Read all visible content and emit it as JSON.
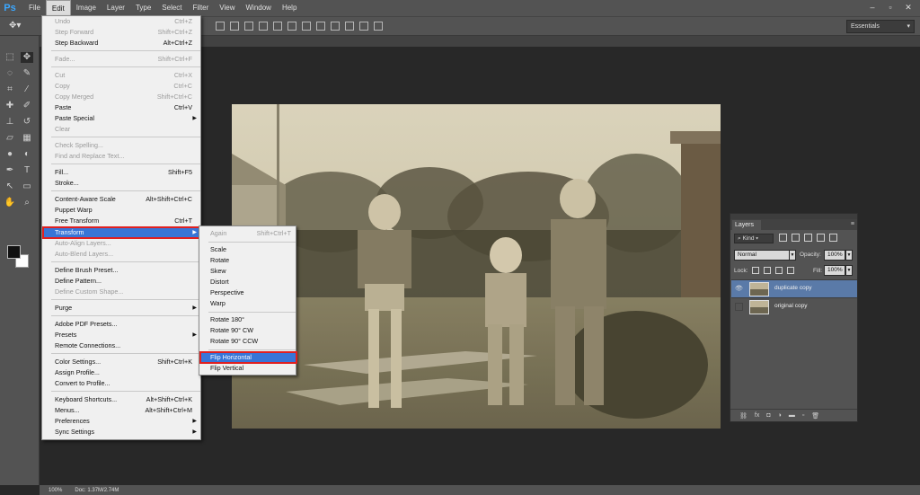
{
  "app": {
    "logo": "Ps"
  },
  "menubar": [
    "File",
    "Edit",
    "Image",
    "Layer",
    "Type",
    "Select",
    "Filter",
    "View",
    "Window",
    "Help"
  ],
  "window_controls": [
    "–",
    "▫",
    "✕"
  ],
  "options_bar": {
    "workspace": "Essentials"
  },
  "edit_menu": {
    "items": [
      {
        "label": "Undo",
        "shortcut": "Ctrl+Z",
        "disabled": true
      },
      {
        "label": "Step Forward",
        "shortcut": "Shift+Ctrl+Z",
        "disabled": true
      },
      {
        "label": "Step Backward",
        "shortcut": "Alt+Ctrl+Z",
        "disabled": false
      },
      {
        "label": "Fade...",
        "shortcut": "Shift+Ctrl+F",
        "disabled": true
      },
      {
        "label": "Cut",
        "shortcut": "Ctrl+X",
        "disabled": true
      },
      {
        "label": "Copy",
        "shortcut": "Ctrl+C",
        "disabled": true
      },
      {
        "label": "Copy Merged",
        "shortcut": "Shift+Ctrl+C",
        "disabled": true
      },
      {
        "label": "Paste",
        "shortcut": "Ctrl+V",
        "disabled": false
      },
      {
        "label": "Paste Special",
        "shortcut": "",
        "disabled": false
      },
      {
        "label": "Clear",
        "shortcut": "",
        "disabled": true
      },
      {
        "label": "Check Spelling...",
        "shortcut": "",
        "disabled": true
      },
      {
        "label": "Find and Replace Text...",
        "shortcut": "",
        "disabled": true
      },
      {
        "label": "Fill...",
        "shortcut": "Shift+F5",
        "disabled": false
      },
      {
        "label": "Stroke...",
        "shortcut": "",
        "disabled": false
      },
      {
        "label": "Content-Aware Scale",
        "shortcut": "Alt+Shift+Ctrl+C",
        "disabled": false
      },
      {
        "label": "Puppet Warp",
        "shortcut": "",
        "disabled": false
      },
      {
        "label": "Free Transform",
        "shortcut": "Ctrl+T",
        "disabled": false
      },
      {
        "label": "Transform",
        "shortcut": "",
        "disabled": false
      },
      {
        "label": "Auto-Align Layers...",
        "shortcut": "",
        "disabled": true
      },
      {
        "label": "Auto-Blend Layers...",
        "shortcut": "",
        "disabled": true
      },
      {
        "label": "Define Brush Preset...",
        "shortcut": "",
        "disabled": false
      },
      {
        "label": "Define Pattern...",
        "shortcut": "",
        "disabled": false
      },
      {
        "label": "Define Custom Shape...",
        "shortcut": "",
        "disabled": true
      },
      {
        "label": "Purge",
        "shortcut": "",
        "disabled": false
      },
      {
        "label": "Adobe PDF Presets...",
        "shortcut": "",
        "disabled": false
      },
      {
        "label": "Presets",
        "shortcut": "",
        "disabled": false
      },
      {
        "label": "Remote Connections...",
        "shortcut": "",
        "disabled": false
      },
      {
        "label": "Color Settings...",
        "shortcut": "Shift+Ctrl+K",
        "disabled": false
      },
      {
        "label": "Assign Profile...",
        "shortcut": "",
        "disabled": false
      },
      {
        "label": "Convert to Profile...",
        "shortcut": "",
        "disabled": false
      },
      {
        "label": "Keyboard Shortcuts...",
        "shortcut": "Alt+Shift+Ctrl+K",
        "disabled": false
      },
      {
        "label": "Menus...",
        "shortcut": "Alt+Shift+Ctrl+M",
        "disabled": false
      },
      {
        "label": "Preferences",
        "shortcut": "",
        "disabled": false
      },
      {
        "label": "Sync Settings",
        "shortcut": "",
        "disabled": false
      }
    ]
  },
  "transform_submenu": {
    "items": [
      {
        "label": "Again",
        "shortcut": "Shift+Ctrl+T",
        "disabled": true
      },
      {
        "label": "Scale",
        "shortcut": ""
      },
      {
        "label": "Rotate",
        "shortcut": ""
      },
      {
        "label": "Skew",
        "shortcut": ""
      },
      {
        "label": "Distort",
        "shortcut": ""
      },
      {
        "label": "Perspective",
        "shortcut": ""
      },
      {
        "label": "Warp",
        "shortcut": ""
      },
      {
        "label": "Rotate 180°",
        "shortcut": ""
      },
      {
        "label": "Rotate 90° CW",
        "shortcut": ""
      },
      {
        "label": "Rotate 90° CCW",
        "shortcut": ""
      },
      {
        "label": "Flip Horizontal",
        "shortcut": ""
      },
      {
        "label": "Flip Vertical",
        "shortcut": ""
      }
    ]
  },
  "layers_panel": {
    "tab": "Layers",
    "kind": "Kind",
    "blend_mode": "Normal",
    "opacity_label": "Opacity:",
    "opacity": "100%",
    "lock_label": "Lock:",
    "fill_label": "Fill:",
    "fill": "100%",
    "layers": [
      {
        "name": "duplicate copy",
        "selected": true,
        "visible": true
      },
      {
        "name": "original copy",
        "selected": false,
        "visible": false
      }
    ]
  },
  "status_bar": {
    "zoom": "100%",
    "doc": "Doc: 1.37M/2.74M"
  },
  "colors": {
    "menu_highlight": "#3875d7",
    "callout_outline": "#e02020",
    "panel_bg": "#535353",
    "canvas_bg": "#282828",
    "selected_layer": "#5a7aa8"
  }
}
